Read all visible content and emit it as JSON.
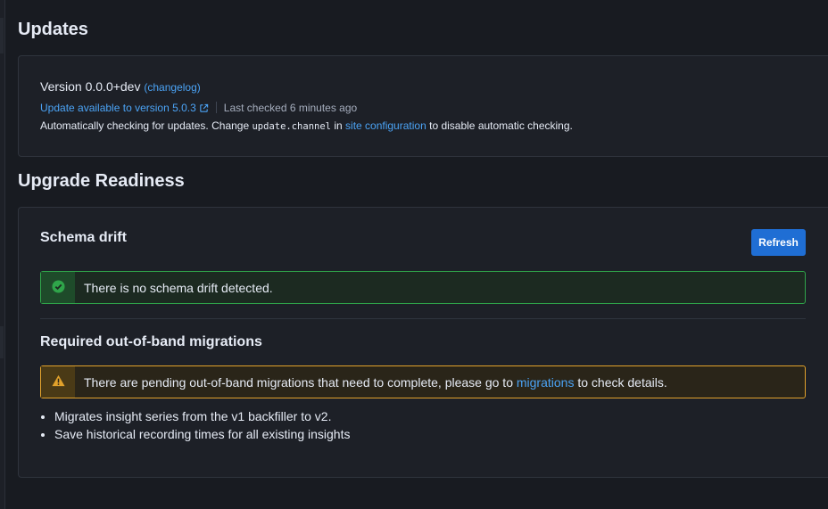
{
  "updates": {
    "title": "Updates",
    "version_label": "Version 0.0.0+dev",
    "changelog_paren_open": "(",
    "changelog_link": "changelog",
    "changelog_paren_close": ")",
    "update_link": "Update available to version 5.0.3",
    "last_checked": "Last checked 6 minutes ago",
    "auto_check_prefix": "Automatically checking for updates. Change",
    "auto_check_code": "update.channel",
    "auto_check_in": "in",
    "auto_check_link": "site configuration",
    "auto_check_suffix": "to disable automatic checking.",
    "external_icon": "external-link-icon"
  },
  "readiness": {
    "title": "Upgrade Readiness",
    "schema_drift": {
      "title": "Schema drift",
      "refresh_label": "Refresh",
      "status_text": "There is no schema drift detected.",
      "status_icon": "check-circle-icon",
      "status_color": "#2fa54a"
    },
    "oob": {
      "title": "Required out-of-band migrations",
      "warning_prefix": "There are pending out-of-band migrations that need to complete, please go to",
      "warning_link": "migrations",
      "warning_suffix": "to check details.",
      "warning_icon": "warning-triangle-icon",
      "warning_color": "#e2a22b",
      "items": [
        "Migrates insight series from the v1 backfiller to v2.",
        "Save historical recording times for all existing insights"
      ]
    }
  },
  "colors": {
    "background": "#181b21",
    "card": "#1d2027",
    "link": "#4ba3f5",
    "primary_button": "#1f6ed4"
  }
}
